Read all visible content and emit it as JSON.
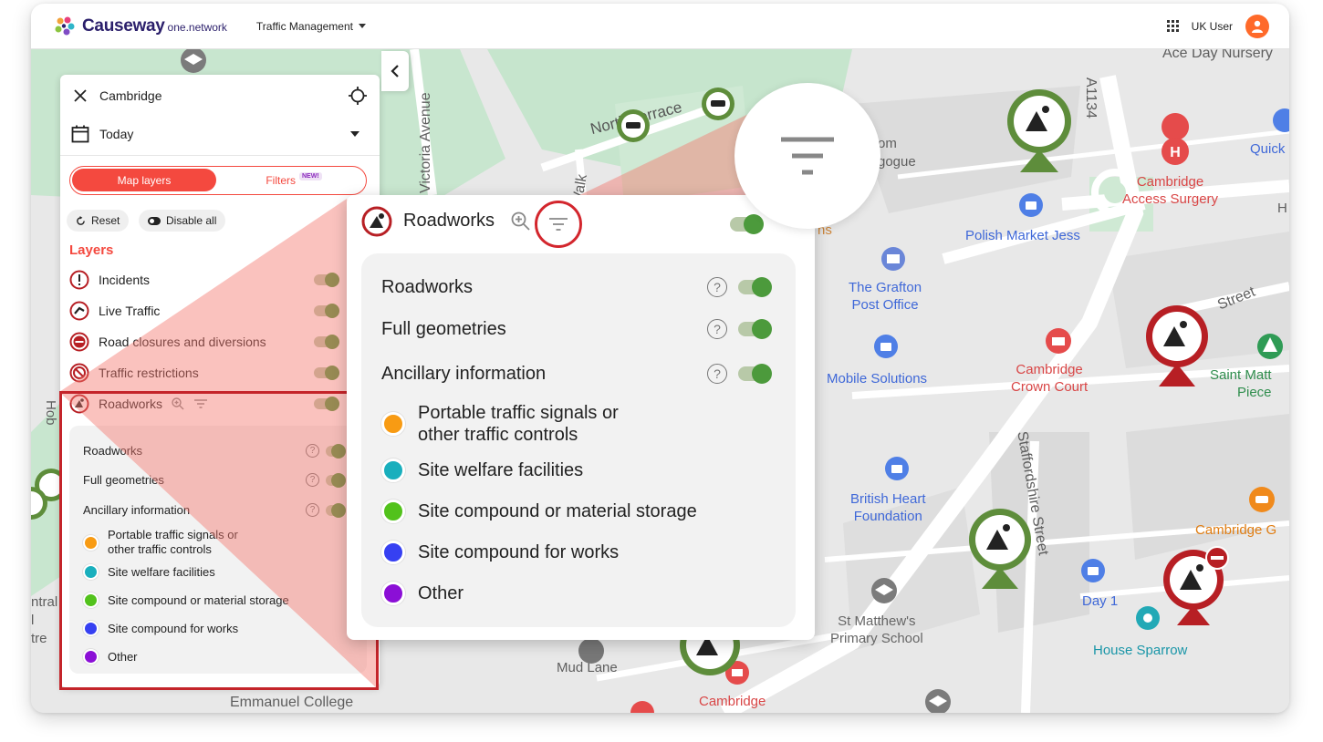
{
  "header": {
    "logo_word": "Causeway",
    "logo_sub": "one.network",
    "app_menu": "Traffic Management",
    "user": "UK User"
  },
  "panel": {
    "location": "Cambridge",
    "date": "Today",
    "tabs": {
      "map_layers": "Map layers",
      "filters": "Filters",
      "new_badge": "NEW!"
    },
    "reset": "Reset",
    "disable_all": "Disable all",
    "layers_title": "Layers",
    "layers": [
      {
        "label": "Incidents",
        "on": true
      },
      {
        "label": "Live Traffic",
        "on": true
      },
      {
        "label": "Road closures and diversions",
        "on": true
      },
      {
        "label": "Traffic restrictions",
        "on": true
      },
      {
        "label": "Roadworks",
        "on": true
      }
    ]
  },
  "roadworks": {
    "title": "Roadworks",
    "toggles": [
      {
        "label": "Roadworks",
        "on": true
      },
      {
        "label": "Full geometries",
        "on": true
      },
      {
        "label": "Ancillary information",
        "on": true
      }
    ],
    "ancillary": [
      {
        "label_line1": "Portable traffic signals or",
        "label_line2": "other traffic controls",
        "color": "#f89b13"
      },
      {
        "label_line1": "Site welfare facilities",
        "label_line2": "",
        "color": "#19afbd"
      },
      {
        "label_line1": "Site compound or material storage",
        "label_line2": "",
        "color": "#52c21c"
      },
      {
        "label_line1": "Site compound for works",
        "label_line2": "",
        "color": "#3640f2"
      },
      {
        "label_line1": "Other",
        "label_line2": "",
        "color": "#8b0fd6"
      }
    ]
  },
  "map": {
    "streets": [
      "Victoria Avenue",
      "North Terrace",
      "ick Walk",
      "A1134",
      "Staffordshire Street",
      "Street",
      "Mud Lane",
      "Emmanuel College",
      "Ace Day Nursery",
      "ns",
      "om",
      "gogue",
      "Hob",
      "ntral",
      "l",
      "tre",
      "H"
    ],
    "pois": [
      {
        "name_line1": "Cambridge",
        "name_line2": "Access Surgery",
        "color": "red"
      },
      {
        "name_line1": "Polish Market Jess",
        "name_line2": "",
        "color": "blue"
      },
      {
        "name_line1": "The Grafton",
        "name_line2": "Post Office",
        "color": "blue"
      },
      {
        "name_line1": "Mobile Solutions",
        "name_line2": "",
        "color": "blue"
      },
      {
        "name_line1": "Cambridge",
        "name_line2": "Crown Court",
        "color": "red"
      },
      {
        "name_line1": "Saint Matt",
        "name_line2": "Piece",
        "color": "green"
      },
      {
        "name_line1": "British Heart",
        "name_line2": "Foundation",
        "color": "blue"
      },
      {
        "name_line1": "Cambridge G",
        "name_line2": "",
        "color": "orange"
      },
      {
        "name_line1": "Day 1",
        "name_line2": "",
        "color": "blue"
      },
      {
        "name_line1": "House Sparrow",
        "name_line2": "",
        "color": "teal"
      },
      {
        "name_line1": "St Matthew's",
        "name_line2": "Primary School",
        "color": "grey"
      },
      {
        "name_line1": "Cambridge",
        "name_line2": "",
        "color": "red"
      },
      {
        "name_line1": "Quick",
        "name_line2": "",
        "color": "blue"
      }
    ]
  }
}
